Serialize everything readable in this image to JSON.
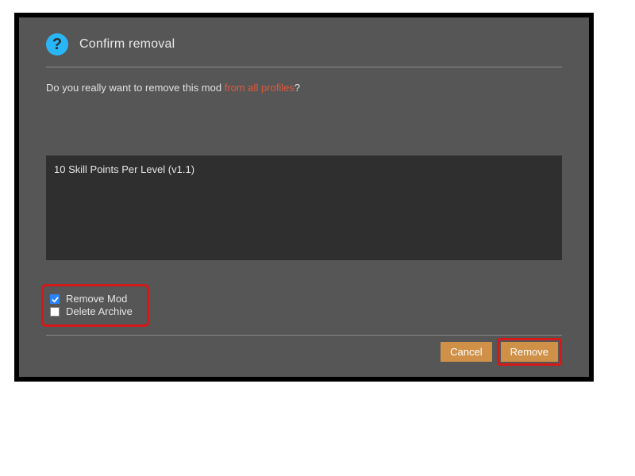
{
  "dialog": {
    "title": "Confirm removal",
    "prompt_prefix": "Do you really want to remove this mod ",
    "prompt_emph": "from all profiles",
    "prompt_suffix": "?"
  },
  "mods": [
    "10 Skill Points Per Level (v1.1)"
  ],
  "options": {
    "remove_mod": {
      "label": "Remove Mod",
      "checked": true
    },
    "delete_archive": {
      "label": "Delete Archive",
      "checked": false
    }
  },
  "buttons": {
    "cancel": "Cancel",
    "remove": "Remove"
  }
}
